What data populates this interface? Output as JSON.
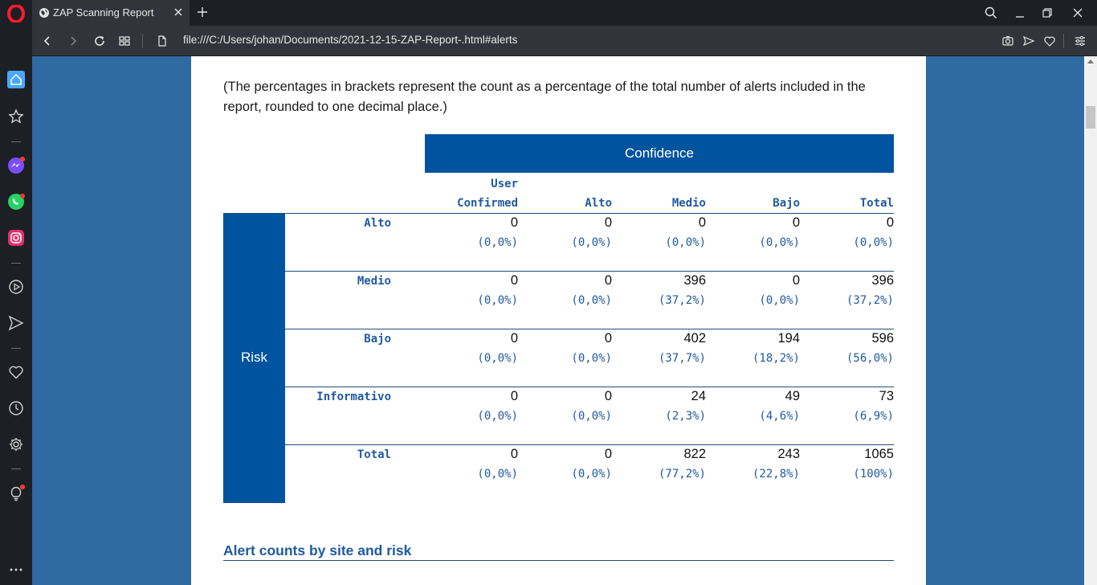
{
  "browser": {
    "tab_title": "ZAP Scanning Report",
    "url": "file:///C:/Users/johan/Documents/2021-12-15-ZAP-Report-.html#alerts"
  },
  "page": {
    "note": "(The percentages in brackets represent the count as a percentage of the total number of alerts included in the report, rounded to one decimal place.)",
    "confidence_label": "Confidence",
    "risk_label": "Risk",
    "columns": [
      "User Confirmed",
      "Alto",
      "Medio",
      "Bajo",
      "Total"
    ],
    "column_user_line1": "User",
    "column_user_line2": "Confirmed",
    "rows": [
      {
        "label": "Alto",
        "counts": [
          "0",
          "0",
          "0",
          "0",
          "0"
        ],
        "pcts": [
          "(0,0%)",
          "(0,0%)",
          "(0,0%)",
          "(0,0%)",
          "(0,0%)"
        ]
      },
      {
        "label": "Medio",
        "counts": [
          "0",
          "0",
          "396",
          "0",
          "396"
        ],
        "pcts": [
          "(0,0%)",
          "(0,0%)",
          "(37,2%)",
          "(0,0%)",
          "(37,2%)"
        ]
      },
      {
        "label": "Bajo",
        "counts": [
          "0",
          "0",
          "402",
          "194",
          "596"
        ],
        "pcts": [
          "(0,0%)",
          "(0,0%)",
          "(37,7%)",
          "(18,2%)",
          "(56,0%)"
        ]
      },
      {
        "label": "Informativo",
        "counts": [
          "0",
          "0",
          "24",
          "49",
          "73"
        ],
        "pcts": [
          "(0,0%)",
          "(0,0%)",
          "(2,3%)",
          "(4,6%)",
          "(6,9%)"
        ]
      },
      {
        "label": "Total",
        "counts": [
          "0",
          "0",
          "822",
          "243",
          "1065"
        ],
        "pcts": [
          "(0,0%)",
          "(0,0%)",
          "(77,2%)",
          "(22,8%)",
          "(100%)"
        ]
      }
    ],
    "next_heading": "Alert counts by site and risk"
  },
  "colors": {
    "accent": "#00539f",
    "page_bg": "#2f6aa3",
    "chrome": "#31353b"
  }
}
